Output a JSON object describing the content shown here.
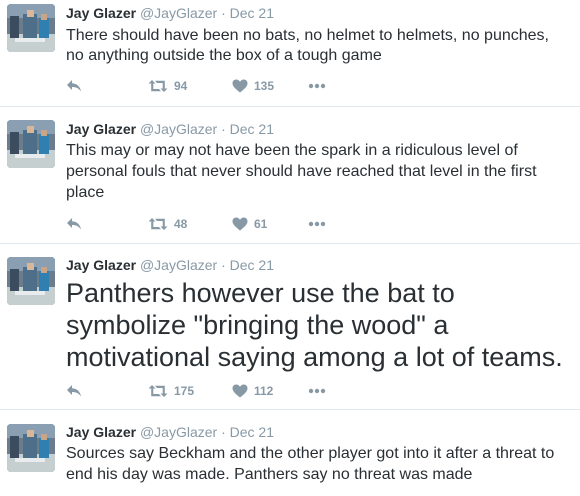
{
  "tweets": [
    {
      "name": "Jay Glazer",
      "handle": "@JayGlazer",
      "dot": "·",
      "date": "Dec 21",
      "text": "There should have been no bats, no helmet to helmets, no punches, no anything outside the box of a tough game",
      "retweets": "94",
      "likes": "135",
      "size": "small"
    },
    {
      "name": "Jay Glazer",
      "handle": "@JayGlazer",
      "dot": "·",
      "date": "Dec 21",
      "text": "This may or may not have been the spark in a ridiculous level of personal fouls that never should have reached that level in the first place",
      "retweets": "48",
      "likes": "61",
      "size": "small"
    },
    {
      "name": "Jay Glazer",
      "handle": "@JayGlazer",
      "dot": "·",
      "date": "Dec 21",
      "text": "Panthers however use the bat to symbolize \"bringing the wood\" a motivational saying among a lot of teams.",
      "retweets": "175",
      "likes": "112",
      "size": "big"
    },
    {
      "name": "Jay Glazer",
      "handle": "@JayGlazer",
      "dot": "·",
      "date": "Dec 21",
      "text": "Sources say Beckham and the other player got into it after a threat to end his day was made. Panthers say no threat was made",
      "size": "small"
    }
  ],
  "icons": {
    "reply": "reply-icon",
    "retweet": "retweet-icon",
    "like": "heart-icon",
    "more": "more-icon"
  },
  "colors": {
    "text": "#292f33",
    "meta": "#8899a6",
    "divider": "#e1e8ed"
  }
}
